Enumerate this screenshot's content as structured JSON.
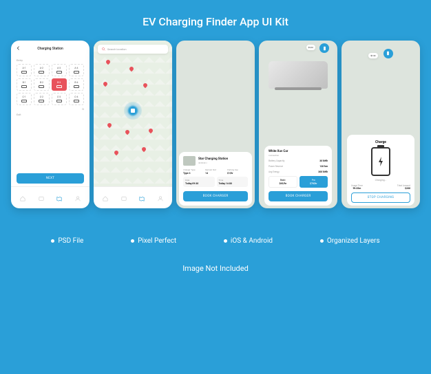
{
  "page_title": "EV Charging Finder App UI Kit",
  "features": [
    "PSD File",
    "Pixel Perfect",
    "iOS & Android",
    "Organized Layers"
  ],
  "footnote": "Image Not Included",
  "colors": {
    "accent": "#2a9fd8",
    "danger": "#e8525b"
  },
  "screen1": {
    "header": "Charging Station",
    "entry_label": "Entry",
    "rows": {
      "a": [
        "A-1",
        "A-2",
        "A-3",
        "A-4"
      ],
      "b": [
        "B-1",
        "B-2",
        "B-3",
        "B-4"
      ],
      "c": [
        "C-1",
        "C-2",
        "C-3",
        "C-4"
      ]
    },
    "selected": "B-3",
    "d_label": "D",
    "exit_label": "Exit",
    "cta": "NEXT"
  },
  "screen2": {
    "search_placeholder": "Search location"
  },
  "screen3": {
    "station_name": "Star Charging Station",
    "rating_display": "★★★★☆",
    "specs": [
      {
        "label": "Charger Type",
        "value": "Type 3"
      },
      {
        "label": "Remain Slot",
        "value": "14"
      },
      {
        "label": "Parking Fee",
        "value": "$1/hr"
      }
    ],
    "date": {
      "label": "Date",
      "value": "Today 09:30"
    },
    "time": {
      "label": "Time",
      "value": "Today 14:00"
    },
    "cta": "BOOK CHARGER"
  },
  "screen4": {
    "rate_badge": "$1/hr",
    "car_name": "White Xuv Car",
    "car_sub": "Connection",
    "specs": [
      {
        "label": "Battery Capacity",
        "value": "30 kWh"
      },
      {
        "label": "Power Reserve",
        "value": "120 km"
      },
      {
        "label": "Avg Energy",
        "value": "300 kWh"
      }
    ],
    "plans": [
      {
        "name": "Basic",
        "price": "$65/hr"
      },
      {
        "name": "Pro",
        "price": "$70/hr"
      }
    ],
    "cta": "BOOK CHARGER"
  },
  "screen5": {
    "rate_badge": "$1/hr",
    "title": "Charge",
    "status": "Charging...",
    "stats": [
      {
        "label": "Usage Time",
        "value": "9h 35m"
      },
      {
        "label": "Total Amount",
        "value": "$200"
      }
    ],
    "cta": "STOP CHARGING"
  }
}
